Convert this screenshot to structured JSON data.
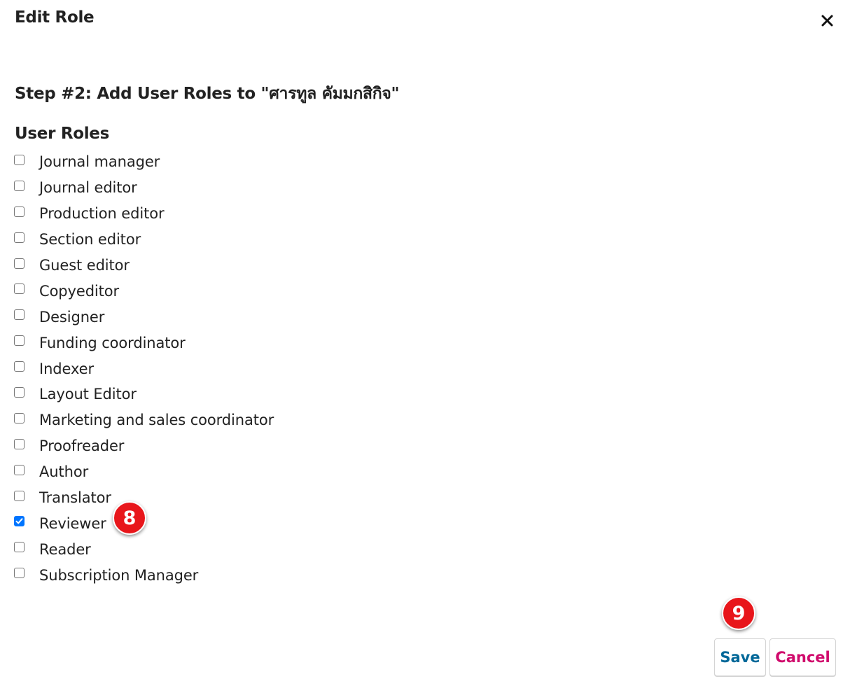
{
  "dialog": {
    "title": "Edit Role",
    "close_icon": "close-icon"
  },
  "step": {
    "heading": "Step #2: Add User Roles to \"ศารทูล คัมมกสิกิจ\""
  },
  "roles": {
    "label": "User Roles",
    "items": [
      {
        "label": "Journal manager",
        "checked": false
      },
      {
        "label": "Journal editor",
        "checked": false
      },
      {
        "label": "Production editor",
        "checked": false
      },
      {
        "label": "Section editor",
        "checked": false
      },
      {
        "label": "Guest editor",
        "checked": false
      },
      {
        "label": "Copyeditor",
        "checked": false
      },
      {
        "label": "Designer",
        "checked": false
      },
      {
        "label": "Funding coordinator",
        "checked": false
      },
      {
        "label": "Indexer",
        "checked": false
      },
      {
        "label": "Layout Editor",
        "checked": false
      },
      {
        "label": "Marketing and sales coordinator",
        "checked": false
      },
      {
        "label": "Proofreader",
        "checked": false
      },
      {
        "label": "Author",
        "checked": false
      },
      {
        "label": "Translator",
        "checked": false
      },
      {
        "label": "Reviewer",
        "checked": true
      },
      {
        "label": "Reader",
        "checked": false
      },
      {
        "label": "Subscription Manager",
        "checked": false
      }
    ]
  },
  "annotations": {
    "step_8": "8",
    "step_9": "9"
  },
  "actions": {
    "save_label": "Save",
    "cancel_label": "Cancel"
  },
  "colors": {
    "save_text": "#006798",
    "cancel_text": "#d00a6c",
    "badge_fill": "#e8161b",
    "checkbox_checked": "#0075ff"
  }
}
